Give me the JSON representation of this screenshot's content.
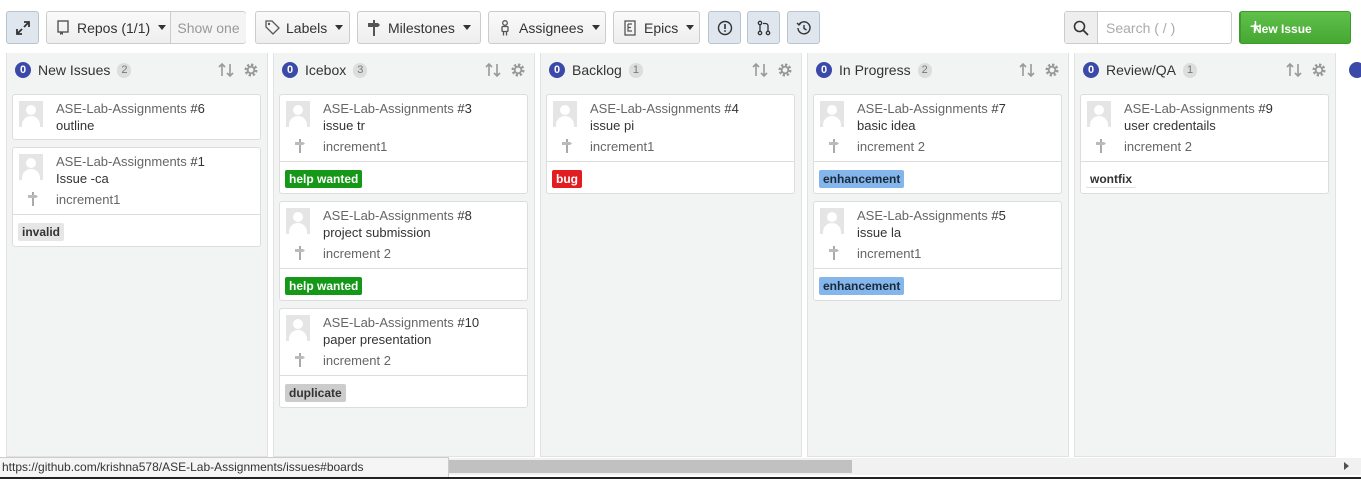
{
  "toolbar": {
    "repos_label": "Repos (1/1)",
    "show_one_label": "Show one",
    "labels_label": "Labels",
    "milestones_label": "Milestones",
    "assignees_label": "Assignees",
    "epics_label": "Epics",
    "search_placeholder": "Search ( / )",
    "new_issue_label": "New Issue",
    "new_issue_plus": "+"
  },
  "columns": [
    {
      "zero": "0",
      "title": "New Issues",
      "count": "2",
      "cards": [
        {
          "repo": "ASE-Lab-Assignments",
          "num": "#6",
          "title": "outline",
          "milestone": "",
          "label": ""
        },
        {
          "repo": "ASE-Lab-Assignments",
          "num": "#1",
          "title": "Issue -ca",
          "milestone": "increment1",
          "label": "invalid",
          "label_bg": "#e6e6e6",
          "label_fg": "#333"
        }
      ]
    },
    {
      "zero": "0",
      "title": "Icebox",
      "count": "3",
      "cards": [
        {
          "repo": "ASE-Lab-Assignments",
          "num": "#3",
          "title": "issue tr",
          "milestone": "increment1",
          "label": "help wanted",
          "label_bg": "#159818",
          "label_fg": "#fff"
        },
        {
          "repo": "ASE-Lab-Assignments",
          "num": "#8",
          "title": "project submission",
          "milestone": "increment 2",
          "label": "help wanted",
          "label_bg": "#159818",
          "label_fg": "#fff"
        },
        {
          "repo": "ASE-Lab-Assignments",
          "num": "#10",
          "title": "paper presentation",
          "milestone": "increment 2",
          "label": "duplicate",
          "label_bg": "#cccccc",
          "label_fg": "#333"
        }
      ]
    },
    {
      "zero": "0",
      "title": "Backlog",
      "count": "1",
      "cards": [
        {
          "repo": "ASE-Lab-Assignments",
          "num": "#4",
          "title": "issue pi",
          "milestone": "increment1",
          "label": "bug",
          "label_bg": "#e11d21",
          "label_fg": "#fff"
        }
      ]
    },
    {
      "zero": "0",
      "title": "In Progress",
      "count": "2",
      "cards": [
        {
          "repo": "ASE-Lab-Assignments",
          "num": "#7",
          "title": "basic idea",
          "milestone": "increment 2",
          "label": "enhancement",
          "label_bg": "#84b6eb",
          "label_fg": "#1a2a3a"
        },
        {
          "repo": "ASE-Lab-Assignments",
          "num": "#5",
          "title": "issue la",
          "milestone": "increment1",
          "label": "enhancement",
          "label_bg": "#84b6eb",
          "label_fg": "#1a2a3a"
        }
      ]
    },
    {
      "zero": "0",
      "title": "Review/QA",
      "count": "1",
      "cards": [
        {
          "repo": "ASE-Lab-Assignments",
          "num": "#9",
          "title": "user credentails",
          "milestone": "increment 2",
          "label": "wontfix",
          "label_bg": "#ffffff",
          "label_fg": "#333"
        }
      ]
    }
  ],
  "status_url": "https://github.com/krishna578/ASE-Lab-Assignments/issues#boards"
}
